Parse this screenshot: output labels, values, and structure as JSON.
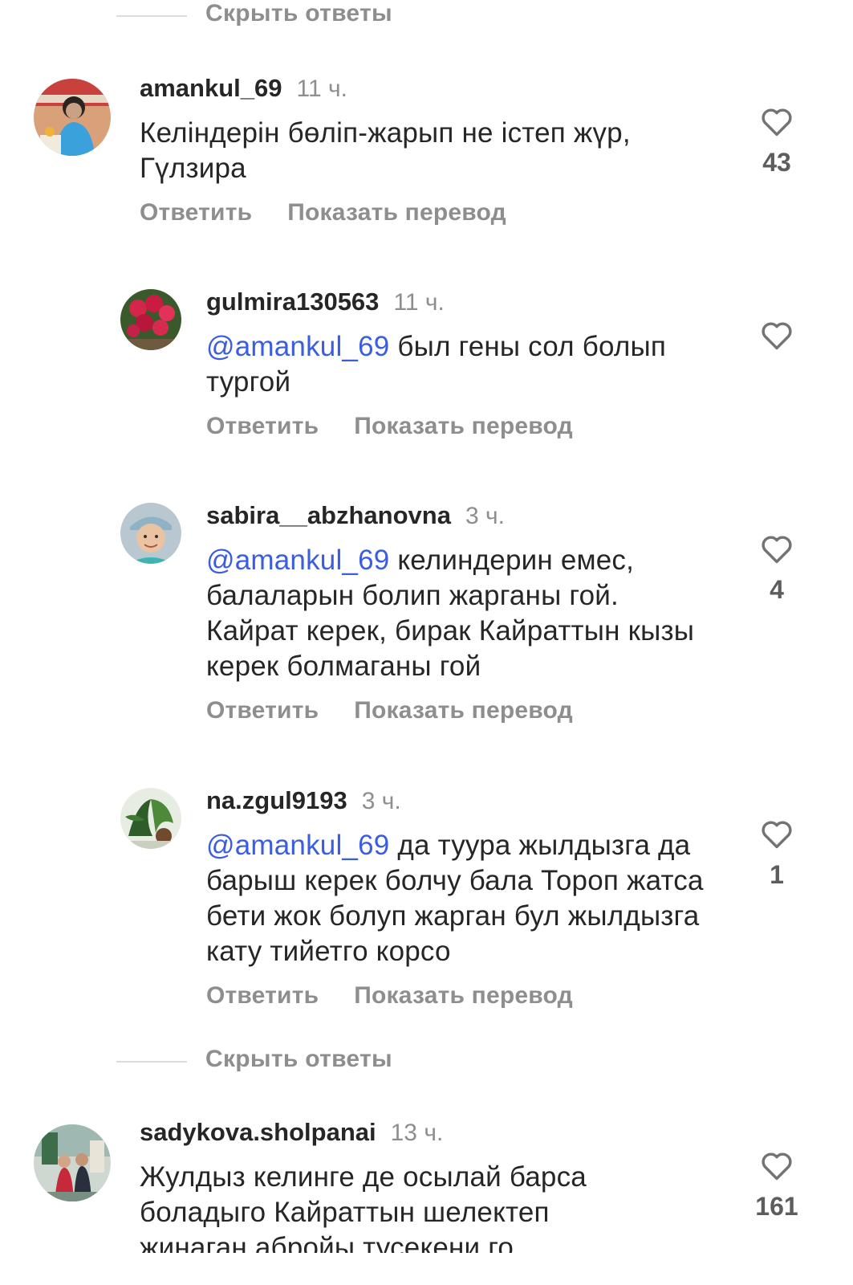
{
  "hide_replies_label": "Скрыть ответы",
  "reply_label": "Ответить",
  "translate_label": "Показать перевод",
  "comments": [
    {
      "user": "amankul_69",
      "time": "11 ч.",
      "mention": "",
      "text": "Келіндерін бөліп-жарып не істеп жүр, Гүлзира",
      "likes": "43"
    },
    {
      "user": "gulmira130563",
      "time": "11 ч.",
      "mention": "@amankul_69",
      "text": "был гены сол болып тургой",
      "likes": ""
    },
    {
      "user": "sabira__abzhanovna",
      "time": "3 ч.",
      "mention": "@amankul_69",
      "text": "келиндерин емес, балаларын болип жарганы гой. Кайрат керек, бирак Кайраттын кызы керек болмаганы гой",
      "likes": "4"
    },
    {
      "user": "na.zgul9193",
      "time": "3 ч.",
      "mention": "@amankul_69",
      "text": "да туура жылдызга да барыш керек болчу бала Тороп жатса бети жок болуп жарган бул жылдызга кату тийетго корсо",
      "likes": "1"
    },
    {
      "user": "sadykova.sholpanai",
      "time": "13 ч.",
      "mention": "",
      "text": "Жулдыз келинге де осылай барса боладыго  Кайраттын шелектеп жинаган абройы тусекени го",
      "likes": "161"
    }
  ]
}
